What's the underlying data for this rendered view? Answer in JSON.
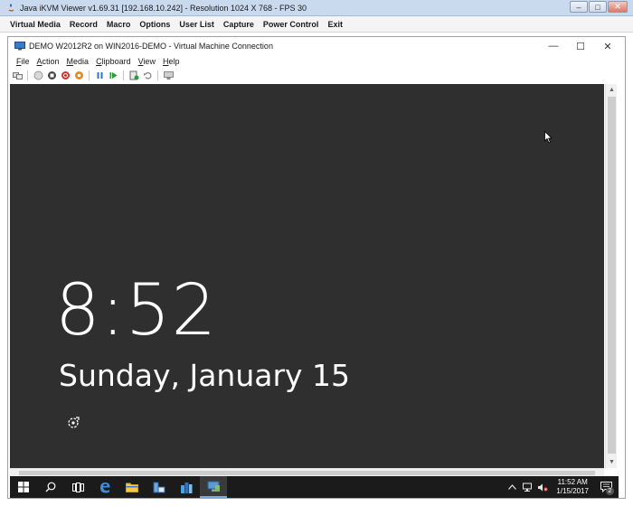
{
  "outer_window": {
    "title": "Java iKVM Viewer v1.69.31 [192.168.10.242]  - Resolution 1024 X 768 - FPS 30",
    "controls": {
      "minimize": "–",
      "maximize": "□",
      "close": "✕"
    },
    "menu": [
      "Virtual Media",
      "Record",
      "Macro",
      "Options",
      "User List",
      "Capture",
      "Power Control",
      "Exit"
    ]
  },
  "vm_window": {
    "title": "DEMO W2012R2 on WIN2016-DEMO - Virtual Machine Connection",
    "controls": {
      "minimize": "—",
      "maximize": "☐",
      "close": "✕"
    },
    "menu": [
      "File",
      "Action",
      "Media",
      "Clipboard",
      "View",
      "Help"
    ],
    "toolbar_icons": [
      "ctrl-alt-del-icon",
      "start-icon",
      "turn-off-icon",
      "shutdown-icon",
      "save-icon",
      "pause-icon",
      "resume-icon",
      "checkpoint-icon",
      "revert-icon",
      "enhanced-session-icon"
    ]
  },
  "lock_screen": {
    "time": "8:52",
    "date": "Sunday, January 15"
  },
  "taskbar": {
    "clock_time": "11:52 AM",
    "clock_date": "1/15/2017",
    "notification_count": "2",
    "accent_color": "#7aa7d8"
  }
}
